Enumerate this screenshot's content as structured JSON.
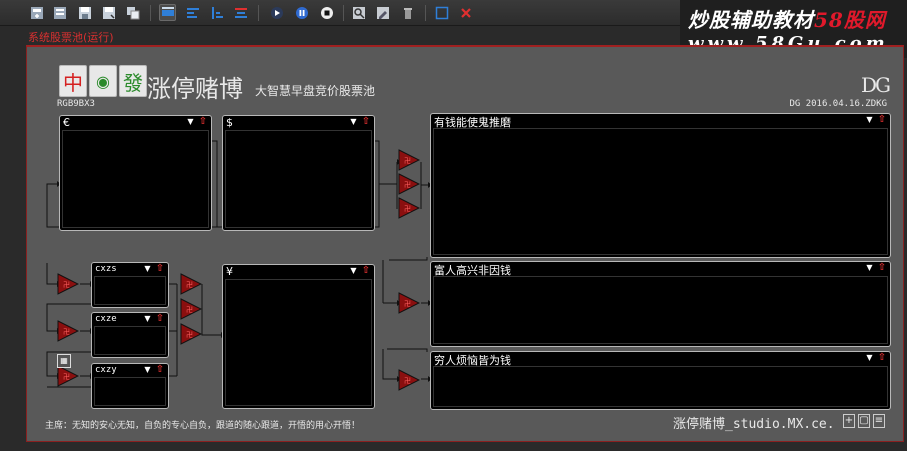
{
  "watermark": {
    "line1_a": "炒股辅助教材",
    "line1_b": "58股网",
    "line2": "www.58Gu.com"
  },
  "pool_label": "系统股票池(运行)",
  "header": {
    "tile1": "中",
    "tile2": "◉",
    "tile3": "發",
    "title": "涨停赌博",
    "subtitle": "大智慧早盘竞价股票池",
    "logo": "DG",
    "rgb": "RGB9BX3",
    "date": "DG 2016.04.16.ZDKG"
  },
  "panels": {
    "euro": "€",
    "dollar": "$",
    "yen": "¥",
    "cxzs": "cxzs",
    "cxze": "cxze",
    "cxzy": "cxzy",
    "right1": "有钱能使鬼推磨",
    "right2": "富人高兴非因钱",
    "right3": "穷人烦恼皆为钱",
    "dropdown_glyph": "▼",
    "up_glyph": "⇧"
  },
  "filter_symbol": "卍",
  "calc_symbol": "▦",
  "footer": {
    "left": "主席：无知的安心无知，自负的专心自负，跟道的随心跟道，开悟的用心开悟！",
    "right": "涨停赌博_studio.MX.ce.",
    "btn1": "+",
    "btn2": "▢",
    "btn3": "≡"
  },
  "colors": {
    "accent_red": "#e03030",
    "frame_bg": "#595959",
    "toolbar_active": "#2f7fd8"
  }
}
